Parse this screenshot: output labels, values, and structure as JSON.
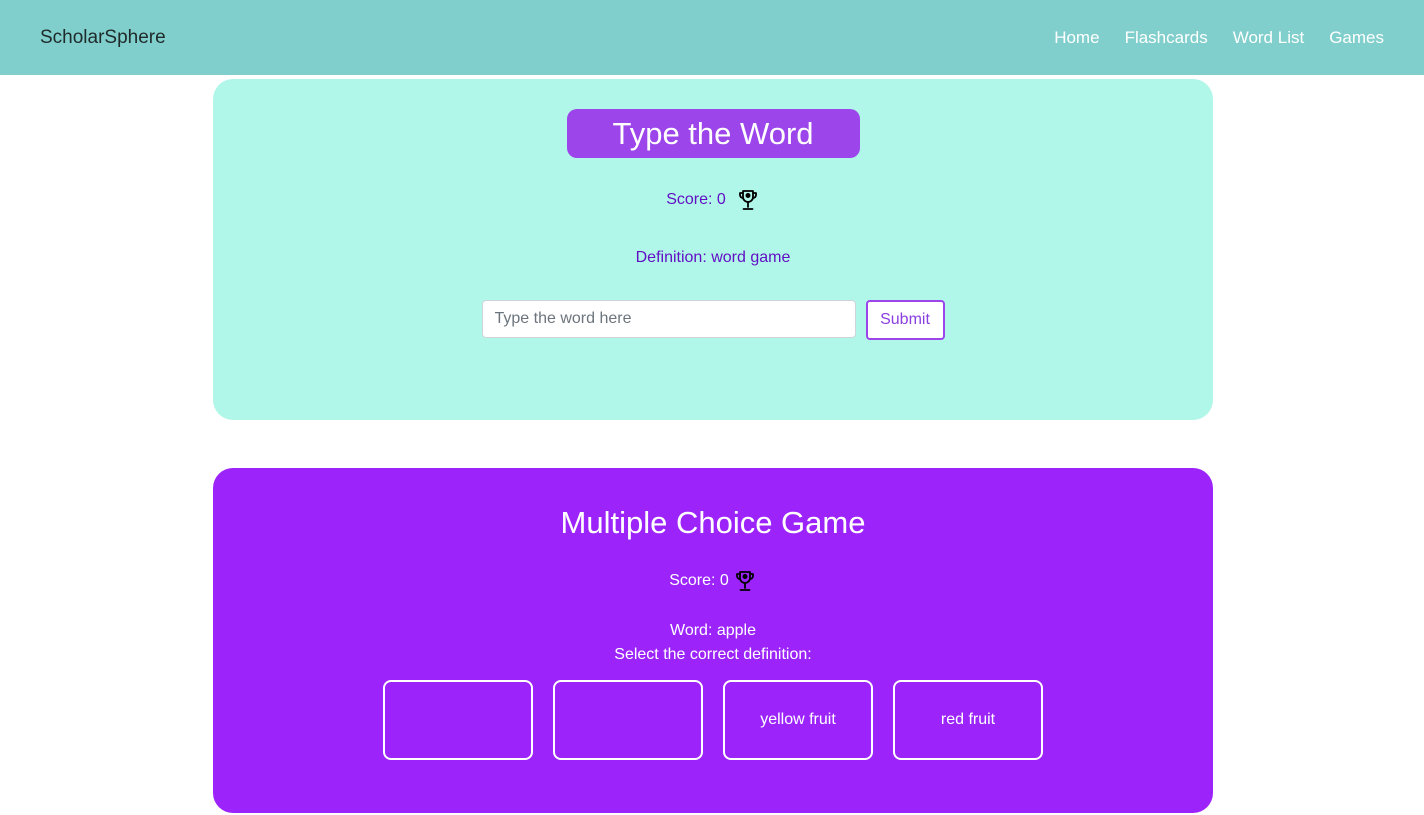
{
  "navbar": {
    "brand": "ScholarSphere",
    "links": [
      "Home",
      "Flashcards",
      "Word List",
      "Games"
    ]
  },
  "type_game": {
    "title": "Type the Word",
    "score_label": "Score: 0",
    "definition": "Definition: word game",
    "input_placeholder": "Type the word here",
    "submit_label": "Submit",
    "icon": "trophy-icon"
  },
  "mc_game": {
    "title": "Multiple Choice Game",
    "score_label": "Score: 0",
    "word_line": "Word: apple",
    "prompt": "Select the correct definition:",
    "options": [
      "",
      "",
      "yellow fruit",
      "red fruit"
    ],
    "icon": "trophy-icon"
  },
  "colors": {
    "navbar": "#80cfcc",
    "type_card": "#b1f7e9",
    "mc_card": "#9c24fb",
    "accent": "#9b45ea"
  }
}
